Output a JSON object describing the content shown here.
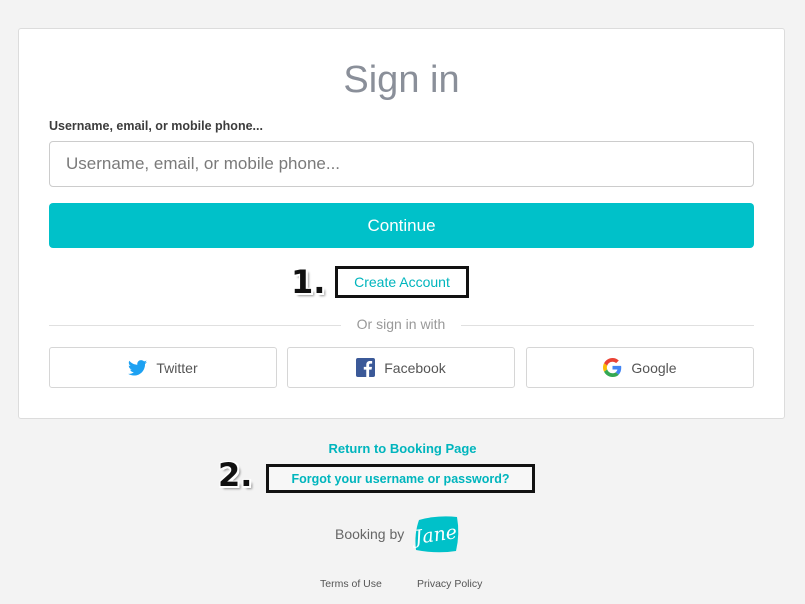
{
  "signin": {
    "title": "Sign in",
    "field_label": "Username, email, or mobile phone...",
    "field_placeholder": "Username, email, or mobile phone...",
    "field_value": "",
    "continue_label": "Continue",
    "create_account_label": "Create Account",
    "or_text": "Or sign in with",
    "social": [
      {
        "label": "Twitter",
        "icon": "twitter-icon",
        "color": "#1da1f2"
      },
      {
        "label": "Facebook",
        "icon": "facebook-icon",
        "color": "#3b5998"
      },
      {
        "label": "Google",
        "icon": "google-icon",
        "color": "#4285f4"
      }
    ]
  },
  "annotations": {
    "one": "1.",
    "two": "2."
  },
  "footer": {
    "return_label": "Return to Booking Page",
    "forgot_label": "Forgot your username or password?",
    "booking_by": "Booking by",
    "brand": "Jane",
    "terms_label": "Terms of Use",
    "privacy_label": "Privacy Policy"
  },
  "colors": {
    "accent": "#00c1c9",
    "link": "#00b5bd",
    "background": "#f3f3f3"
  }
}
